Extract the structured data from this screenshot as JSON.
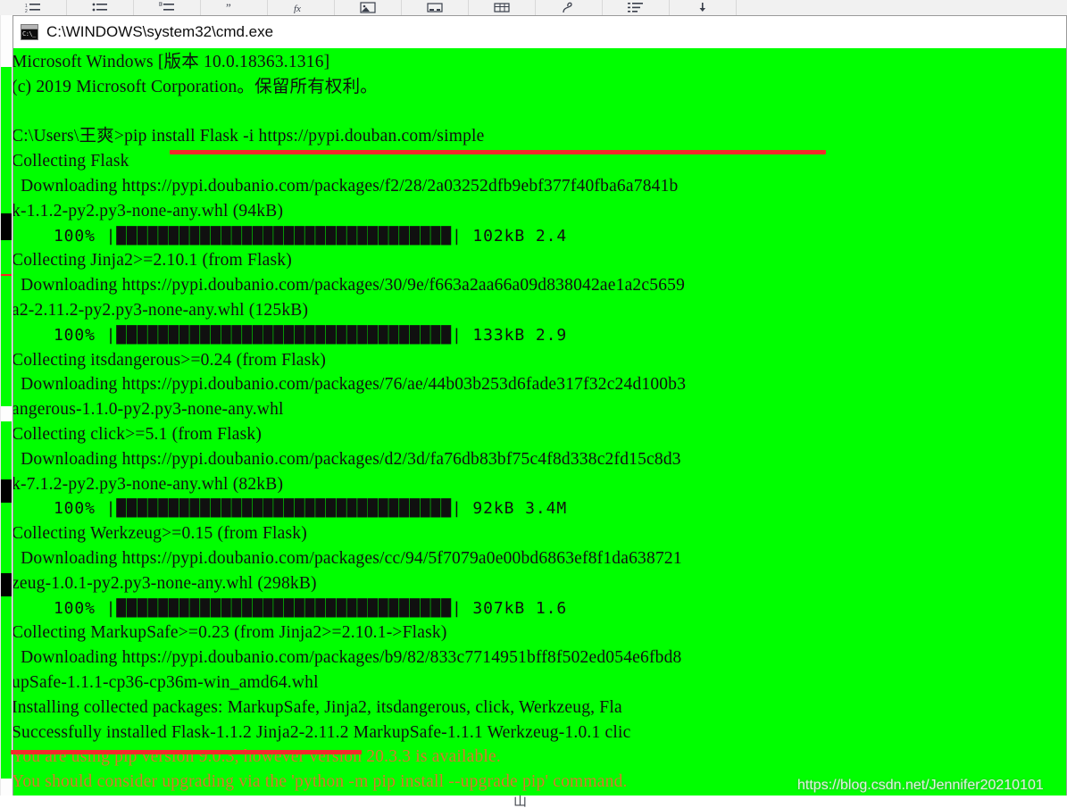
{
  "background_app": {
    "toolbar": {
      "name": "document-editor-toolbar",
      "icons": [
        "numbered-list-icon",
        "bulleted-list-icon",
        "multilevel-list-icon",
        "quote-icon",
        "formula-icon",
        "image-icon",
        "insert-object-icon",
        "table-icon",
        "pen-icon",
        "outline-icon",
        "download-icon"
      ]
    },
    "bottom_glyph": "山"
  },
  "window": {
    "title": "C:\\WINDOWS\\system32\\cmd.exe",
    "icon_name": "cmd-exe-icon",
    "icon_glyph": "C:\\_",
    "background_color": "#00ff00",
    "text_color": "#101010",
    "warning_text_color": "#d8772e",
    "underline_color": "#f42a2a"
  },
  "console": {
    "lines": [
      {
        "text": "Microsoft Windows [版本 10.0.18363.1316]",
        "style": "normal"
      },
      {
        "text": "(c) 2019 Microsoft Corporation。保留所有权利。",
        "style": "normal"
      },
      {
        "text": "",
        "style": "normal"
      },
      {
        "text": "C:\\Users\\王爽>pip install Flask -i https://pypi.douban.com/simple",
        "style": "normal"
      },
      {
        "text": "Collecting Flask",
        "style": "normal"
      },
      {
        "text": "  Downloading https://pypi.doubanio.com/packages/f2/28/2a03252dfb9ebf377f40fba6a7841b",
        "style": "normal"
      },
      {
        "text": "k-1.1.2-py2.py3-none-any.whl (94kB)",
        "style": "normal"
      },
      {
        "text": "    100% |████████████████████████████████| 102kB 2.4",
        "style": "bar"
      },
      {
        "text": "Collecting Jinja2>=2.10.1 (from Flask)",
        "style": "normal"
      },
      {
        "text": "  Downloading https://pypi.doubanio.com/packages/30/9e/f663a2aa66a09d838042ae1a2c5659",
        "style": "normal"
      },
      {
        "text": "a2-2.11.2-py2.py3-none-any.whl (125kB)",
        "style": "normal"
      },
      {
        "text": "    100% |████████████████████████████████| 133kB 2.9",
        "style": "bar"
      },
      {
        "text": "Collecting itsdangerous>=0.24 (from Flask)",
        "style": "normal"
      },
      {
        "text": "  Downloading https://pypi.doubanio.com/packages/76/ae/44b03b253d6fade317f32c24d100b3",
        "style": "normal"
      },
      {
        "text": "angerous-1.1.0-py2.py3-none-any.whl",
        "style": "normal"
      },
      {
        "text": "Collecting click>=5.1 (from Flask)",
        "style": "normal"
      },
      {
        "text": "  Downloading https://pypi.doubanio.com/packages/d2/3d/fa76db83bf75c4f8d338c2fd15c8d3",
        "style": "normal"
      },
      {
        "text": "k-7.1.2-py2.py3-none-any.whl (82kB)",
        "style": "normal"
      },
      {
        "text": "    100% |████████████████████████████████| 92kB 3.4M",
        "style": "bar"
      },
      {
        "text": "Collecting Werkzeug>=0.15 (from Flask)",
        "style": "normal"
      },
      {
        "text": "  Downloading https://pypi.doubanio.com/packages/cc/94/5f7079a0e00bd6863ef8f1da638721",
        "style": "normal"
      },
      {
        "text": "zeug-1.0.1-py2.py3-none-any.whl (298kB)",
        "style": "normal"
      },
      {
        "text": "    100% |████████████████████████████████| 307kB 1.6",
        "style": "bar"
      },
      {
        "text": "Collecting MarkupSafe>=0.23 (from Jinja2>=2.10.1->Flask)",
        "style": "normal"
      },
      {
        "text": "  Downloading https://pypi.doubanio.com/packages/b9/82/833c7714951bff8f502ed054e6fbd8",
        "style": "normal"
      },
      {
        "text": "upSafe-1.1.1-cp36-cp36m-win_amd64.whl",
        "style": "normal"
      },
      {
        "text": "Installing collected packages: MarkupSafe, Jinja2, itsdangerous, click, Werkzeug, Fla",
        "style": "normal"
      },
      {
        "text": "Successfully installed Flask-1.1.2 Jinja2-2.11.2 MarkupSafe-1.1.1 Werkzeug-1.0.1 clic",
        "style": "normal"
      },
      {
        "text": "You are using pip version 9.0.3, however version 20.3.3 is available.",
        "style": "warn"
      },
      {
        "text": "You should consider upgrading via the 'python -m pip install --upgrade pip' command.",
        "style": "warn"
      }
    ]
  },
  "annotations": {
    "command_underline": "pip install Flask -i https://pypi.douban.com/simple",
    "warning_underline": "You are using pip version 9.0.3,"
  },
  "watermark": {
    "text": "https://blog.csdn.net/Jennifer20210101"
  }
}
